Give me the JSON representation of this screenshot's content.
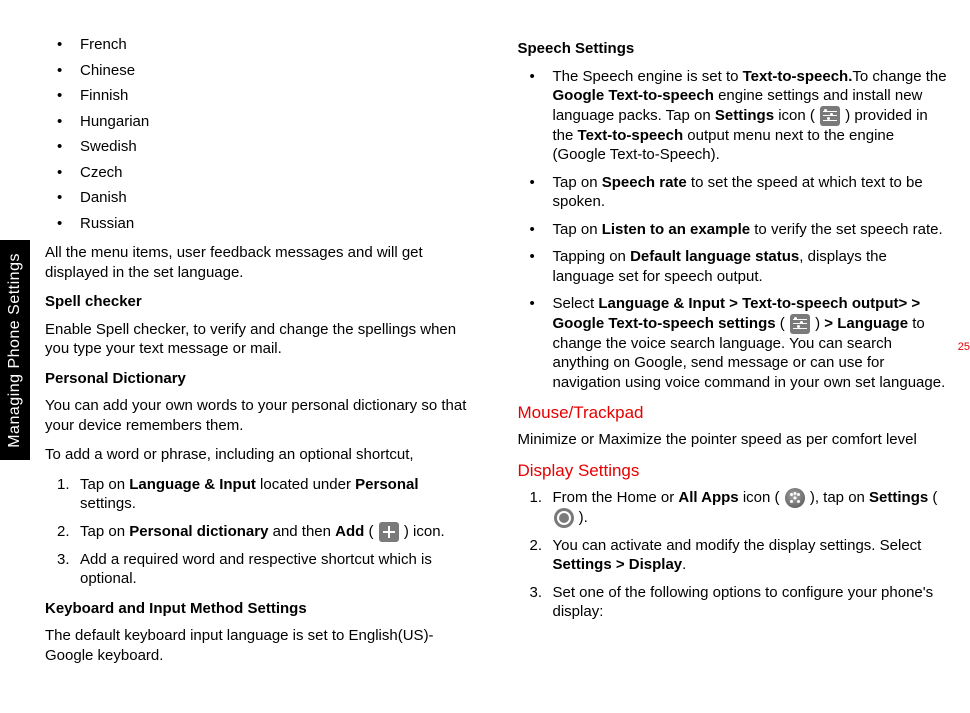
{
  "sidebar_label": "Managing Phone Settings",
  "page_number": "25",
  "left": {
    "languages": [
      "French",
      "Chinese",
      "Finnish",
      "Hungarian",
      "Swedish",
      "Czech",
      "Danish",
      "Russian"
    ],
    "lang_note": "All the menu items, user feedback messages and will get displayed in the set language.",
    "spell_head": "Spell checker",
    "spell_body": "Enable Spell checker, to verify and change the spellings when you type your text message or mail.",
    "pd_head": "Personal Dictionary",
    "pd_body1": "You can add your own words to your personal dictionary so that your device remembers them.",
    "pd_body2": "To add a word or phrase, including an optional shortcut,",
    "pd_step1_a": "Tap on ",
    "pd_step1_b": "Language & Input",
    "pd_step1_c": " located under ",
    "pd_step1_d": "Personal",
    "pd_step1_e": " settings.",
    "pd_step2_a": "Tap on ",
    "pd_step2_b": "Personal dictionary",
    "pd_step2_c": " and then ",
    "pd_step2_d": "Add",
    "pd_step2_e": " ( ",
    "pd_step2_f": " ) icon.",
    "pd_step3": "Add a required word and respective shortcut which is optional.",
    "kb_head": "Keyboard and Input Method Settings",
    "kb_body": "The default keyboard input language is set to English(US)-Google keyboard."
  },
  "right": {
    "speech_head": "Speech Settings",
    "sp1_a": "The Speech engine is set to ",
    "sp1_b": "Text-to-speech.",
    "sp1_c": "To change the ",
    "sp1_d": "Google Text-to-speech",
    "sp1_e": " engine settings and install new language packs. Tap on ",
    "sp1_f": "Settings",
    "sp1_g": " icon ( ",
    "sp1_h": " ) provided in the ",
    "sp1_i": "Text-to-speech",
    "sp1_j": " output menu next to the engine (Google Text-to-Speech).",
    "sp2_a": "Tap on ",
    "sp2_b": "Speech rate",
    "sp2_c": "  to set the speed at which text to be spoken.",
    "sp3_a": "Tap on ",
    "sp3_b": "Listen to an example",
    "sp3_c": " to verify the set speech rate.",
    "sp4_a": "Tapping on ",
    "sp4_b": "Default language status",
    "sp4_c": ", displays the language set for speech output.",
    "sp5_a": "Select ",
    "sp5_b": "Language & Input > Text-to-speech output> > Google Text-to-speech settings",
    "sp5_c": " ( ",
    "sp5_d": " ) ",
    "sp5_e": "> Language",
    "sp5_f": " to change the voice search language. You can search anything on Google, send message or can use for navigation using voice command in your own set language.",
    "mouse_title": "Mouse/Trackpad",
    "mouse_body": "Minimize or Maximize the pointer speed as per comfort level",
    "display_title": "Display Settings",
    "ds1_a": "From the Home or ",
    "ds1_b": "All Apps",
    "ds1_c": " icon ( ",
    "ds1_d": " ), tap on ",
    "ds1_e": "Settings",
    "ds1_f": " ( ",
    "ds1_g": " ).",
    "ds2_a": "You can activate and modify the display settings. Select ",
    "ds2_b": "Settings > Display",
    "ds2_c": ".",
    "ds3": "Set one of the following options to configure your phone's display:"
  }
}
